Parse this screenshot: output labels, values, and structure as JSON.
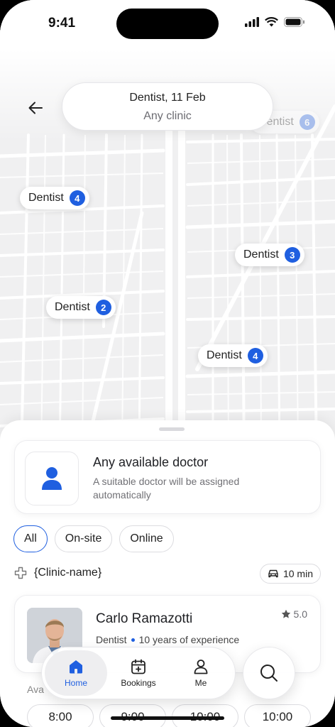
{
  "status_bar": {
    "time": "9:41"
  },
  "header": {
    "search_line1": "Dentist, 11 Feb",
    "search_line2": "Any clinic"
  },
  "map_pins": [
    {
      "label": "Dentist",
      "count": "4"
    },
    {
      "label": "Dentist",
      "count": "3"
    },
    {
      "label": "Dentist",
      "count": "2"
    },
    {
      "label": "Dentist",
      "count": "4"
    },
    {
      "label": "Dentist",
      "count": "6"
    }
  ],
  "any_doctor": {
    "title": "Any available doctor",
    "subtitle": "A suitable doctor will be assigned automatically"
  },
  "filters": [
    "All",
    "On-site",
    "Online"
  ],
  "active_filter": "All",
  "clinic": {
    "name": "{Clinic-name}",
    "travel_time": "10 min"
  },
  "doctor": {
    "name": "Carlo Ramazotti",
    "rating": "5.0",
    "specialty": "Dentist",
    "experience": "10 years of experience"
  },
  "availability_label": "Ava",
  "time_slots": [
    "8:00",
    "9:00",
    "10:00",
    "10:00"
  ],
  "nav": {
    "items": [
      {
        "label": "Home",
        "icon": "home-icon",
        "active": true
      },
      {
        "label": "Bookings",
        "icon": "calendar-plus-icon",
        "active": false
      },
      {
        "label": "Me",
        "icon": "person-icon",
        "active": false
      }
    ],
    "search_icon": "search-icon"
  },
  "colors": {
    "accent": "#1f5fe0",
    "text": "#1f2024",
    "muted": "#707075"
  }
}
